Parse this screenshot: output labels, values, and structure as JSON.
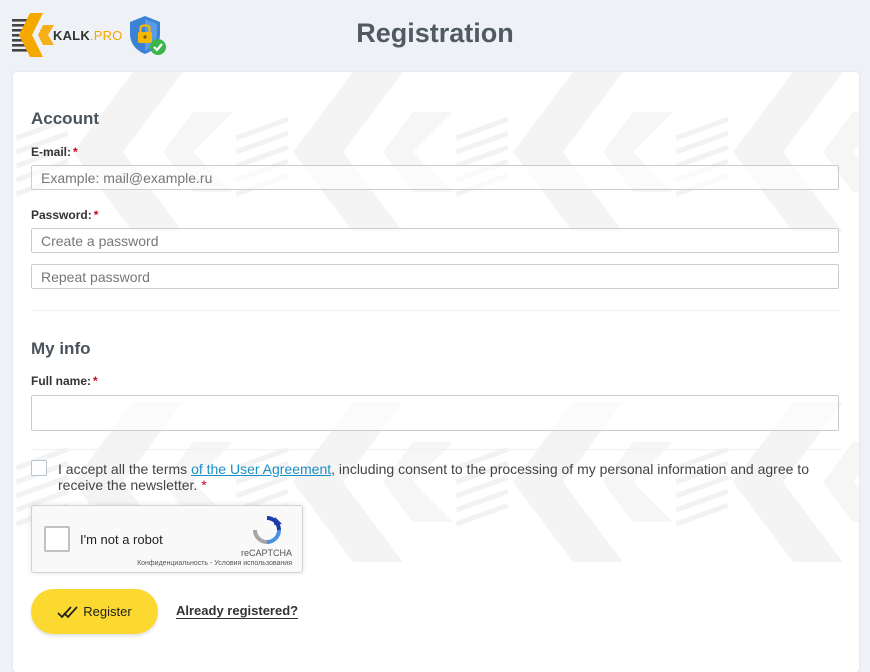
{
  "header": {
    "logo_text_main": "KALK",
    "logo_text_suffix": ".PRO",
    "title": "Registration"
  },
  "account": {
    "section_title": "Account",
    "email_label": "E-mail:",
    "email_placeholder": "Example: mail@example.ru",
    "password_label": "Password:",
    "password_placeholder": "Create a password",
    "repeat_placeholder": "Repeat password",
    "required_mark": "*"
  },
  "my_info": {
    "section_title": "My info",
    "fullname_label": "Full name:",
    "fullname_value": ""
  },
  "terms": {
    "text_before": "I accept all the terms ",
    "link_text": "of the User Agreement",
    "text_after": ", including consent to the processing of my personal information and agree to receive the newsletter. ",
    "checked": false
  },
  "recaptcha": {
    "label": "I'm not a robot",
    "brand": "reCAPTCHA",
    "links": "Конфиденциальность - Условия использования"
  },
  "actions": {
    "register_label": "Register",
    "already_label": "Already registered?"
  },
  "colors": {
    "accent": "#fcd931",
    "logo_orange": "#f5a800",
    "link": "#1a8fc4",
    "required": "#d0021b",
    "shield": "#3b82d6",
    "check_green": "#3bb54a"
  }
}
